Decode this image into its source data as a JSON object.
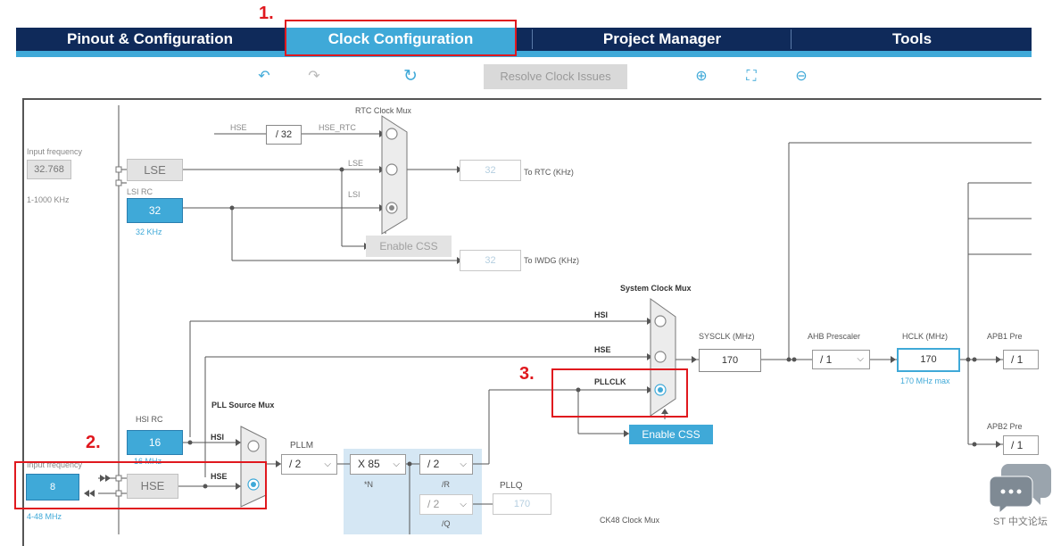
{
  "tabs": [
    {
      "label": "Pinout & Configuration",
      "active": false
    },
    {
      "label": "Clock Configuration",
      "active": true
    },
    {
      "label": "Project Manager",
      "active": false
    },
    {
      "label": "Tools",
      "active": false
    }
  ],
  "toolbar": {
    "undo_icon": "↶",
    "redo_icon": "↷",
    "refresh_icon": "↻",
    "resolve_label": "Resolve Clock Issues",
    "zoom_in_icon": "⊕",
    "fit_icon": "⛶",
    "zoom_out_icon": "⊖"
  },
  "annotations": {
    "step1": "1.",
    "step2": "2.",
    "step3": "3."
  },
  "colors": {
    "navy": "#0f2a5a",
    "accent": "#3fa9d8",
    "red": "#e0181e"
  },
  "lse": {
    "input_label": "Input frequency",
    "input_value": "32.768",
    "range": "1-1000 KHz",
    "block": "LSE"
  },
  "lsi": {
    "label": "LSI RC",
    "value": "32",
    "unit": "32 KHz"
  },
  "rtc": {
    "mux_label": "RTC Clock Mux",
    "hse_label": "HSE",
    "div": "/ 32",
    "hse_rtc": "HSE_RTC",
    "lse": "LSE",
    "lsi": "LSI",
    "out_value": "32",
    "out_label": "To RTC (KHz)"
  },
  "css_rtc": "Enable CSS",
  "iwdg": {
    "value": "32",
    "label": "To IWDG (KHz)"
  },
  "sysmux": {
    "label": "System Clock Mux",
    "hsi": "HSI",
    "hse": "HSE",
    "pllclk": "PLLCLK",
    "css": "Enable CSS"
  },
  "sysclk": {
    "label": "SYSCLK (MHz)",
    "value": "170"
  },
  "ahb": {
    "label": "AHB Prescaler",
    "value": "/ 1"
  },
  "hclk": {
    "label": "HCLK (MHz)",
    "value": "170",
    "max": "170 MHz max"
  },
  "apb1": {
    "label": "APB1 Pre",
    "value": "/ 1"
  },
  "apb2": {
    "label": "APB2 Pre",
    "value": "/ 1"
  },
  "hsi_rc": {
    "label": "HSI RC",
    "value": "16",
    "unit": "16 MHz"
  },
  "pll": {
    "mux_label": "PLL Source Mux",
    "hsi": "HSI",
    "hse": "HSE",
    "pllm_label": "PLLM",
    "pllm_value": "/ 2",
    "n_value": "X 85",
    "n_label": "*N",
    "r_value": "/ 2",
    "r_label": "/R",
    "q_value": "/ 2",
    "q_label": "/Q",
    "pllq_label": "PLLQ",
    "pllq_value": "170",
    "ck48_label": "CK48 Clock Mux"
  },
  "hse": {
    "input_label": "Input frequency",
    "input_value": "8",
    "range": "4-48 MHz",
    "block": "HSE"
  },
  "watermark": {
    "text": "ST 中文论坛"
  }
}
